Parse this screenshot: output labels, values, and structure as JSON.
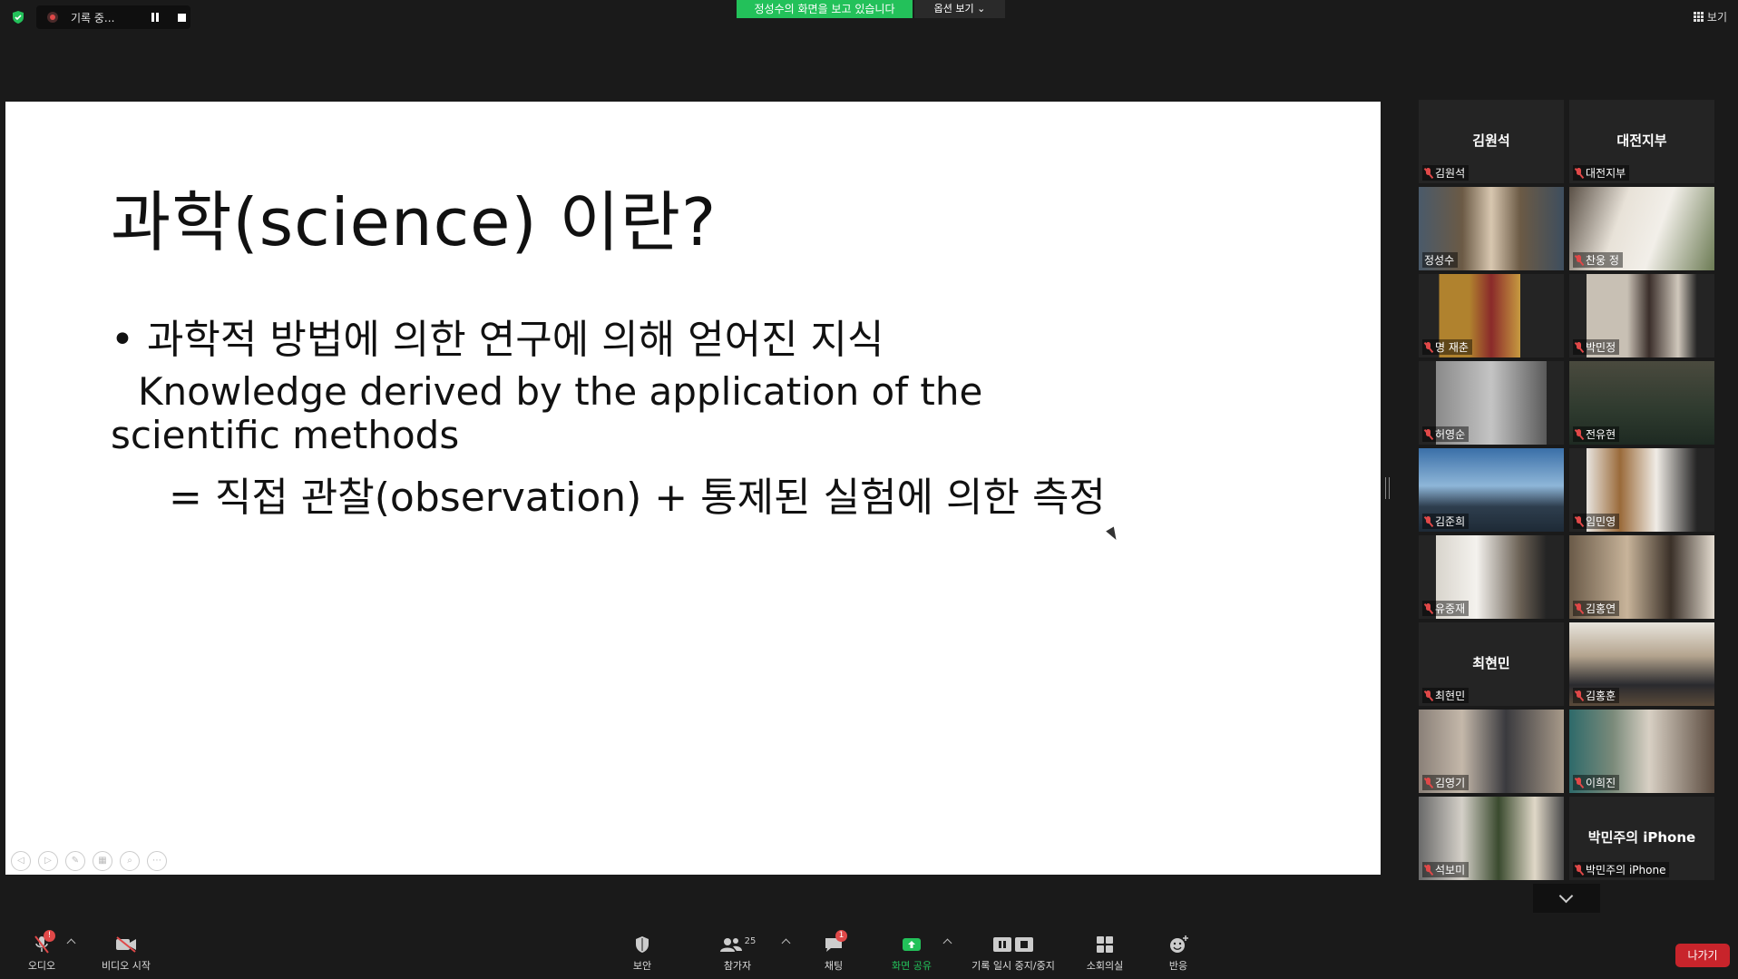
{
  "topbar": {
    "recording_label": "기록 중...",
    "viewing_banner": "정성수의 화면을 보고 있습니다",
    "view_options": "옵션 보기",
    "view_button": "보기"
  },
  "slide": {
    "title": "과학(science) 이란?",
    "bullet": "• 과학적 방법에 의한 연구에 의해 얻어진 지식",
    "english": "Knowledge derived by the application of the scientific methods",
    "equation": "= 직접 관찰(observation) + 통제된 실험에 의한 측정"
  },
  "gallery": {
    "tiles": [
      {
        "big": "김원석",
        "label": "김원석"
      },
      {
        "big": "대전지부",
        "label": "대전지부"
      },
      {
        "big": "",
        "label": "정성수"
      },
      {
        "big": "",
        "label": "찬웅 정"
      },
      {
        "big": "",
        "label": "명 재춘"
      },
      {
        "big": "",
        "label": "박민정"
      },
      {
        "big": "",
        "label": "허영순"
      },
      {
        "big": "",
        "label": "전유현"
      },
      {
        "big": "",
        "label": "김준희"
      },
      {
        "big": "",
        "label": "임민영"
      },
      {
        "big": "",
        "label": "유중재"
      },
      {
        "big": "",
        "label": "김홍연"
      },
      {
        "big": "최현민",
        "label": "최현민"
      },
      {
        "big": "",
        "label": "김홍훈"
      },
      {
        "big": "",
        "label": "김영기"
      },
      {
        "big": "",
        "label": "이희진"
      },
      {
        "big": "",
        "label": "석보미"
      },
      {
        "big": "박민주의 iPhone",
        "label": "박민주의 iPhone"
      }
    ]
  },
  "toolbar": {
    "audio": "오디오",
    "video": "비디오 시작",
    "security": "보안",
    "participants": "참가자",
    "participants_count": "25",
    "chat": "채팅",
    "chat_badge": "1",
    "share": "화면 공유",
    "record": "기록 일시 중지/중지",
    "breakout": "소회의실",
    "reactions": "반응",
    "audio_badge": "!",
    "leave": "나가기"
  },
  "colors": {
    "green": "#23c15a",
    "leave_red": "#c8242b",
    "active_speaker": "#f0e36b"
  }
}
